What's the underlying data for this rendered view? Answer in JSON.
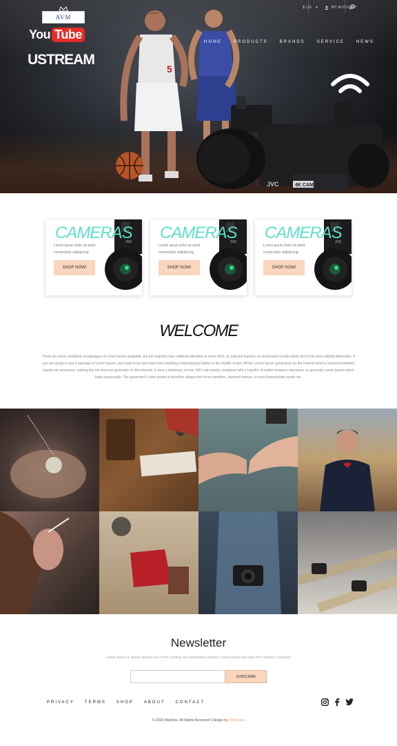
{
  "header": {
    "logo_text": "AVM",
    "currency": "$ US",
    "account": "MY ACCOUNT",
    "nav": [
      "HOME",
      "PRODUCTS",
      "BRANDS",
      "SERVICE",
      "NEWS"
    ]
  },
  "hero": {
    "youtube_you": "You",
    "youtube_tube": "Tube",
    "ustream": "USTREAM"
  },
  "cards": [
    {
      "title": "CAMERAS",
      "desc": "Lorem ipsum dolor sit amet consectetur adipisicing.",
      "button": "SHOP NOW!"
    },
    {
      "title": "CAMERAS",
      "desc": "Lorem ipsum dolor sit amet consectetur adipisicing.",
      "button": "SHOP NOW!"
    },
    {
      "title": "CAMERAS",
      "desc": "Lorem ipsum dolor sit amet consectetur adipisicing.",
      "button": "SHOP NOW!"
    }
  ],
  "welcome": {
    "title": "WELCOME",
    "text": "There are many variations of passages of Lorem Ipsum available, but the majority have suffered alteration in some form, by injected humour, or randomised words which don't look even slightly believable. If you are going to use a passage of Lorem Ipsum, you need to be sure there isn't anything embarrassing hidden in the middle of text. All the Lorem Ipsum generators on the Internet tend to repeat predefined chunks as necessary, making this the first true generator on the Internet. It uses a dictionary of over 200 Latin words, combined with a handful of model sentence structures, to generate Lorem Ipsum which looks reasonable. The generated Lorem Ipsum is therefore always free from repetition, injected humour, or non-characteristic words etc."
  },
  "newsletter": {
    "title": "Newsletter",
    "text": "Lorem Ipsum is simply dummy text of the printing and typesetting industry. Lorem Ipsum has been the industry's standard",
    "input_value": "",
    "button": "SUBSCRIBE"
  },
  "footer": {
    "links": [
      "PRIVACY",
      "TERMS",
      "SHOP",
      "ABOUT",
      "CONTACT"
    ],
    "social_icons": [
      "instagram-icon",
      "facebook-icon",
      "twitter-icon"
    ],
    "copyright": "© 2015 Watches. All Rights Reserved | Design by",
    "designer": "W3layouts"
  },
  "colors": {
    "accent_peach": "#f9d6bd",
    "cameras_teal": "#5ce0c8",
    "youtube_red": "#e52d27"
  }
}
